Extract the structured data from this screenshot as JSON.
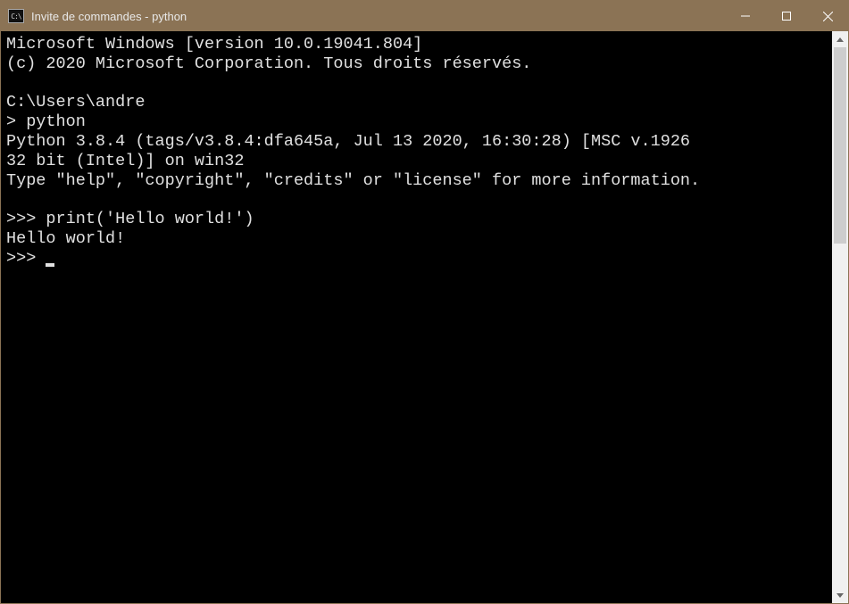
{
  "titlebar": {
    "icon_text": "C:\\",
    "title": "Invite de commandes - python"
  },
  "terminal": {
    "line1": "Microsoft Windows [version 10.0.19041.804]",
    "line2": "(c) 2020 Microsoft Corporation. Tous droits réservés.",
    "blank1": " ",
    "line3": "C:\\Users\\andre",
    "line4": "> python",
    "line5": "Python 3.8.4 (tags/v3.8.4:dfa645a, Jul 13 2020, 16:30:28) [MSC v.1926",
    "line6": "32 bit (Intel)] on win32",
    "line7": "Type \"help\", \"copyright\", \"credits\" or \"license\" for more information.",
    "blank2": " ",
    "line8": ">>> print('Hello world!')",
    "line9": "Hello world!",
    "line10": ">>> "
  }
}
